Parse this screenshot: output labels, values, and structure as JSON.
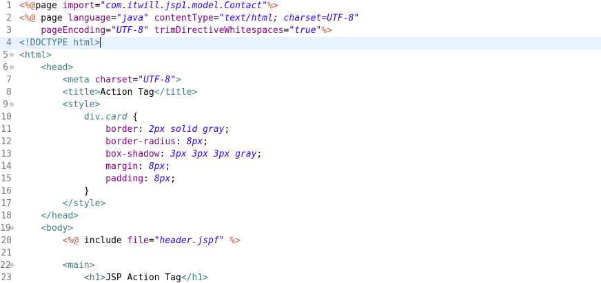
{
  "editor": {
    "lines": [
      {
        "num": "1",
        "fold": "",
        "current": false,
        "tokens": [
          {
            "c": "jsp",
            "t": "<%@"
          },
          {
            "c": "txt",
            "t": "page "
          },
          {
            "c": "attr",
            "t": "import"
          },
          {
            "c": "pun",
            "t": "="
          },
          {
            "c": "str",
            "t": "\"com.itwill.jsp1.model.Contact\""
          },
          {
            "c": "jsp",
            "t": "%>"
          }
        ]
      },
      {
        "num": "2",
        "fold": "",
        "current": false,
        "tokens": [
          {
            "c": "jsp",
            "t": "<%@"
          },
          {
            "c": "txt",
            "t": " page "
          },
          {
            "c": "attr",
            "t": "language"
          },
          {
            "c": "pun",
            "t": "="
          },
          {
            "c": "str",
            "t": "\"java\""
          },
          {
            "c": "txt",
            "t": " "
          },
          {
            "c": "attr",
            "t": "contentType"
          },
          {
            "c": "pun",
            "t": "="
          },
          {
            "c": "str",
            "t": "\"text/html; charset=UTF-8\""
          }
        ]
      },
      {
        "num": "3",
        "fold": "",
        "current": false,
        "tokens": [
          {
            "c": "txt",
            "t": "    "
          },
          {
            "c": "attr",
            "t": "pageEncoding"
          },
          {
            "c": "pun",
            "t": "="
          },
          {
            "c": "str",
            "t": "\"UTF-8\""
          },
          {
            "c": "txt",
            "t": " "
          },
          {
            "c": "attr",
            "t": "trimDirectiveWhitespaces"
          },
          {
            "c": "pun",
            "t": "="
          },
          {
            "c": "str",
            "t": "\"true\""
          },
          {
            "c": "jsp",
            "t": "%>"
          }
        ]
      },
      {
        "num": "4",
        "fold": "",
        "current": true,
        "tokens": [
          {
            "c": "tag",
            "t": "<!DOCTYPE html>"
          }
        ]
      },
      {
        "num": "5",
        "fold": "⊖",
        "current": false,
        "tokens": [
          {
            "c": "tag",
            "t": "<html>"
          }
        ]
      },
      {
        "num": "6",
        "fold": "⊖",
        "current": false,
        "tokens": [
          {
            "c": "txt",
            "t": "    "
          },
          {
            "c": "tag",
            "t": "<head>"
          }
        ]
      },
      {
        "num": "7",
        "fold": "",
        "current": false,
        "tokens": [
          {
            "c": "txt",
            "t": "        "
          },
          {
            "c": "tag",
            "t": "<meta "
          },
          {
            "c": "attr",
            "t": "charset"
          },
          {
            "c": "pun",
            "t": "="
          },
          {
            "c": "str",
            "t": "\"UTF-8\""
          },
          {
            "c": "tag",
            "t": ">"
          }
        ]
      },
      {
        "num": "8",
        "fold": "",
        "current": false,
        "tokens": [
          {
            "c": "txt",
            "t": "        "
          },
          {
            "c": "tag",
            "t": "<title>"
          },
          {
            "c": "txt",
            "t": "Action Tag"
          },
          {
            "c": "tag",
            "t": "</title>"
          }
        ]
      },
      {
        "num": "9",
        "fold": "⊖",
        "current": false,
        "tokens": [
          {
            "c": "txt",
            "t": "        "
          },
          {
            "c": "tag",
            "t": "<style>"
          }
        ]
      },
      {
        "num": "10",
        "fold": "",
        "current": false,
        "tokens": [
          {
            "c": "txt",
            "t": "            "
          },
          {
            "c": "sel",
            "t": "div"
          },
          {
            "c": "cls",
            "t": ".card"
          },
          {
            "c": "txt",
            "t": " {"
          }
        ]
      },
      {
        "num": "11",
        "fold": "",
        "current": false,
        "tokens": [
          {
            "c": "txt",
            "t": "                "
          },
          {
            "c": "prop",
            "t": "border"
          },
          {
            "c": "pun",
            "t": ": "
          },
          {
            "c": "val",
            "t": "2px solid gray"
          },
          {
            "c": "pun",
            "t": ";"
          }
        ]
      },
      {
        "num": "12",
        "fold": "",
        "current": false,
        "tokens": [
          {
            "c": "txt",
            "t": "                "
          },
          {
            "c": "prop",
            "t": "border-radius"
          },
          {
            "c": "pun",
            "t": ": "
          },
          {
            "c": "val",
            "t": "8px"
          },
          {
            "c": "pun",
            "t": ";"
          }
        ]
      },
      {
        "num": "13",
        "fold": "",
        "current": false,
        "tokens": [
          {
            "c": "txt",
            "t": "                "
          },
          {
            "c": "prop",
            "t": "box-shadow"
          },
          {
            "c": "pun",
            "t": ": "
          },
          {
            "c": "val",
            "t": "3px 3px 3px gray"
          },
          {
            "c": "pun",
            "t": ";"
          }
        ]
      },
      {
        "num": "14",
        "fold": "",
        "current": false,
        "tokens": [
          {
            "c": "txt",
            "t": "                "
          },
          {
            "c": "prop",
            "t": "margin"
          },
          {
            "c": "pun",
            "t": ": "
          },
          {
            "c": "val",
            "t": "8px"
          },
          {
            "c": "pun",
            "t": ";"
          }
        ]
      },
      {
        "num": "15",
        "fold": "",
        "current": false,
        "tokens": [
          {
            "c": "txt",
            "t": "                "
          },
          {
            "c": "prop",
            "t": "padding"
          },
          {
            "c": "pun",
            "t": ": "
          },
          {
            "c": "val",
            "t": "8px"
          },
          {
            "c": "pun",
            "t": ";"
          }
        ]
      },
      {
        "num": "16",
        "fold": "",
        "current": false,
        "tokens": [
          {
            "c": "txt",
            "t": "            }"
          }
        ]
      },
      {
        "num": "17",
        "fold": "",
        "current": false,
        "tokens": [
          {
            "c": "txt",
            "t": "        "
          },
          {
            "c": "tag",
            "t": "</style>"
          }
        ]
      },
      {
        "num": "18",
        "fold": "",
        "current": false,
        "tokens": [
          {
            "c": "txt",
            "t": "    "
          },
          {
            "c": "tag",
            "t": "</head>"
          }
        ]
      },
      {
        "num": "19",
        "fold": "⊖",
        "current": false,
        "tokens": [
          {
            "c": "txt",
            "t": "    "
          },
          {
            "c": "tag",
            "t": "<body>"
          }
        ]
      },
      {
        "num": "20",
        "fold": "",
        "current": false,
        "tokens": [
          {
            "c": "txt",
            "t": "        "
          },
          {
            "c": "jsp",
            "t": "<%@"
          },
          {
            "c": "txt",
            "t": " include "
          },
          {
            "c": "attr",
            "t": "file"
          },
          {
            "c": "pun",
            "t": "="
          },
          {
            "c": "str",
            "t": "\"header.jspf\""
          },
          {
            "c": "txt",
            "t": " "
          },
          {
            "c": "jsp",
            "t": "%>"
          }
        ]
      },
      {
        "num": "21",
        "fold": "",
        "current": false,
        "tokens": []
      },
      {
        "num": "22",
        "fold": "⊖",
        "current": false,
        "tokens": [
          {
            "c": "txt",
            "t": "        "
          },
          {
            "c": "tag",
            "t": "<main>"
          }
        ]
      },
      {
        "num": "23",
        "fold": "",
        "current": false,
        "tokens": [
          {
            "c": "txt",
            "t": "            "
          },
          {
            "c": "tag",
            "t": "<h1>"
          },
          {
            "c": "txt",
            "t": "JSP Action Tag"
          },
          {
            "c": "tag",
            "t": "</h1>"
          }
        ]
      }
    ]
  }
}
